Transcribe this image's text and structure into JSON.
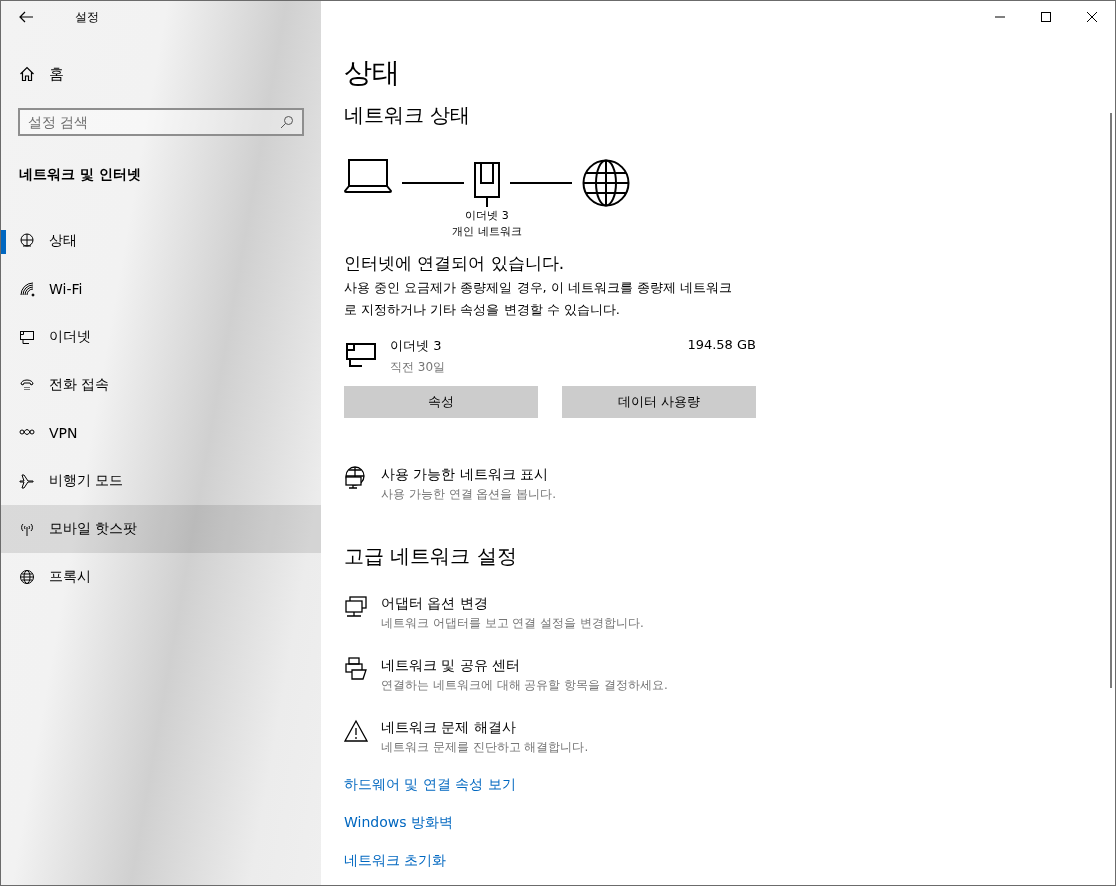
{
  "window": {
    "title": "설정"
  },
  "sidebar": {
    "home": "홈",
    "search": {
      "placeholder": "설정 검색"
    },
    "section": "네트워크 및 인터넷",
    "items": [
      {
        "label": "상태",
        "selected": true,
        "highlighted": false
      },
      {
        "label": "Wi-Fi",
        "selected": false,
        "highlighted": false
      },
      {
        "label": "이더넷",
        "selected": false,
        "highlighted": false
      },
      {
        "label": "전화 접속",
        "selected": false,
        "highlighted": false
      },
      {
        "label": "VPN",
        "selected": false,
        "highlighted": false
      },
      {
        "label": "비행기 모드",
        "selected": false,
        "highlighted": false
      },
      {
        "label": "모바일 핫스팟",
        "selected": false,
        "highlighted": true
      },
      {
        "label": "프록시",
        "selected": false,
        "highlighted": false
      }
    ]
  },
  "content": {
    "title": "상태",
    "subtitle": "네트워크 상태",
    "diagram": {
      "adapter": "이더넷 3",
      "profile": "개인 네트워크"
    },
    "status": "인터넷에 연결되어 있습니다.",
    "description": "사용 중인 요금제가 종량제일 경우, 이 네트워크를 종량제 네트워크로 지정하거나 기타 속성을 변경할 수 있습니다.",
    "connection": {
      "name": "이더넷 3",
      "period": "직전 30일",
      "usage": "194.58 GB"
    },
    "buttons": [
      "속성",
      "데이터 사용량"
    ],
    "show_networks": {
      "title": "사용 가능한 네트워크 표시",
      "subtitle": "사용 가능한 연결 옵션을 봅니다."
    },
    "advanced_title": "고급 네트워크 설정",
    "advanced": [
      {
        "title": "어댑터 옵션 변경",
        "subtitle": "네트워크 어댑터를 보고 연결 설정을 변경합니다."
      },
      {
        "title": "네트워크 및 공유 센터",
        "subtitle": "연결하는 네트워크에 대해 공유할 항목을 결정하세요."
      },
      {
        "title": "네트워크 문제 해결사",
        "subtitle": "네트워크 문제를 진단하고 해결합니다."
      }
    ],
    "links": [
      "하드웨어 및 연결 속성 보기",
      "Windows 방화벽",
      "네트워크 초기화"
    ]
  }
}
